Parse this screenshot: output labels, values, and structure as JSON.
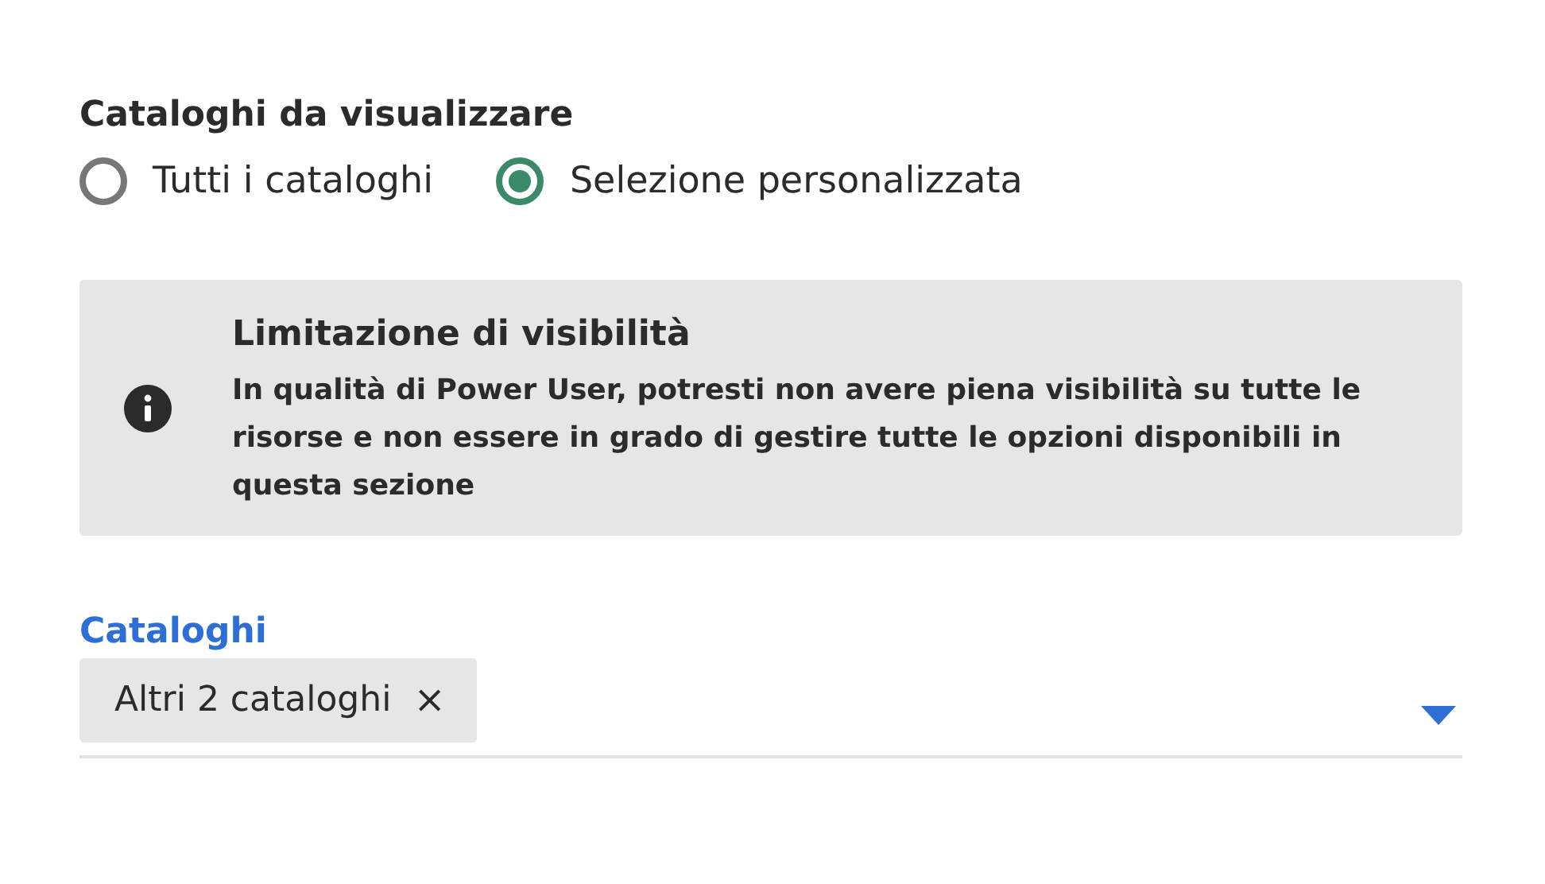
{
  "group": {
    "title": "Cataloghi da visualizzare",
    "options": [
      {
        "label": "Tutti i cataloghi",
        "selected": false
      },
      {
        "label": "Selezione personalizzata",
        "selected": true
      }
    ]
  },
  "notice": {
    "title": "Limitazione di visibilità",
    "text": "In qualità di Power User, potresti non avere piena visibilità su tutte le risorse e non essere in grado di gestire tutte le opzioni disponibili in questa sezione"
  },
  "select": {
    "label": "Cataloghi",
    "chips": [
      {
        "label": "Altri 2 cataloghi",
        "remove": "×"
      }
    ]
  }
}
